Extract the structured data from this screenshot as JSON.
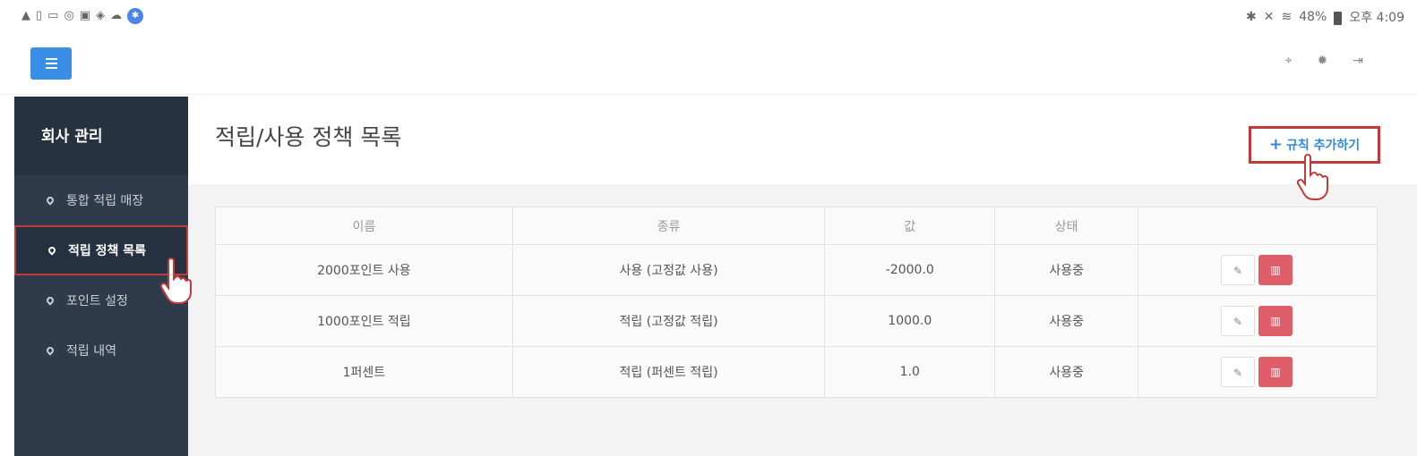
{
  "status_bar": {
    "left_icons": [
      "warning-icon",
      "phone-icon",
      "image-icon",
      "clock-icon",
      "mail-icon",
      "shield-icon",
      "cloud-icon",
      "bluetooth-badge-icon"
    ],
    "battery": "48%",
    "time": "오후 4:09"
  },
  "sidebar": {
    "title": "회사 관리",
    "items": [
      {
        "label": "통합 적립 매장",
        "active": false
      },
      {
        "label": "적립 정책 목록",
        "active": true
      },
      {
        "label": "포인트 설정",
        "active": false
      },
      {
        "label": "적립 내역",
        "active": false
      }
    ]
  },
  "main": {
    "title": "적립/사용 정책 목록",
    "add_button": "규칙 추가하기",
    "table": {
      "headers": [
        "이름",
        "종류",
        "값",
        "상태",
        ""
      ],
      "rows": [
        [
          "2000포인트 사용",
          "사용 (고정값 사용)",
          "-2000.0",
          "사용중"
        ],
        [
          "1000포인트 적립",
          "적립 (고정값 적립)",
          "1000.0",
          "사용중"
        ],
        [
          "1퍼센트",
          "적립 (퍼센트 적립)",
          "1.0",
          "사용중"
        ]
      ]
    }
  },
  "colors": {
    "sidebar_bg": "#2f3b4a",
    "accent_blue": "#3a8ee6",
    "delete_red": "#e05d6a",
    "highlight_red": "#c23b3b"
  }
}
